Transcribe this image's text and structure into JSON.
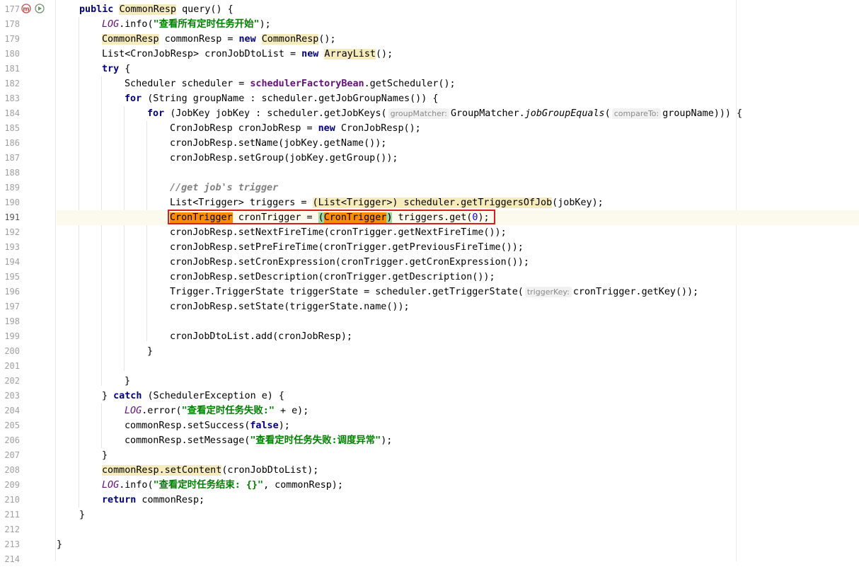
{
  "editor": {
    "line_numbers": [
      "177",
      "178",
      "179",
      "180",
      "181",
      "182",
      "183",
      "184",
      "185",
      "186",
      "187",
      "188",
      "189",
      "190",
      "191",
      "192",
      "193",
      "194",
      "195",
      "196",
      "197",
      "198",
      "199",
      "200",
      "201",
      "202",
      "203",
      "204",
      "205",
      "206",
      "207",
      "208",
      "209",
      "210",
      "211",
      "212",
      "213",
      "214"
    ],
    "current_line": "191",
    "gutter_icons": {
      "line_177": [
        "override-method-icon",
        "run-debug-icon"
      ]
    },
    "hints": {
      "group_matcher": "groupMatcher:",
      "compare_to": "compareTo:",
      "trigger_key": "triggerKey:"
    },
    "tokens": {
      "public": "public",
      "try": "try",
      "for": "for",
      "new": "new",
      "catch": "catch",
      "return": "return",
      "false": "false",
      "CommonResp": "CommonResp",
      "ArrayList": "ArrayList",
      "LOG": "LOG",
      "query": " query() {",
      "str_start": "\"查看所有定时任务开始\"",
      "str_fail": "\"查看定时任务失败:\"",
      "str_fail_msg": "\"查看定时任务失败:调度异常\"",
      "str_end": "\"查看定时任务结束: {}\"",
      "schedulerFactoryBean": "schedulerFactoryBean",
      "jobGroupEquals": "jobGroupEquals",
      "comment": "//get job's trigger",
      "CronTrigger": "CronTrigger",
      "List_Trigger_cast": "(List<Trigger>)",
      "getTriggersOfJob": "scheduler.getTriggersOfJob",
      "zero": "0",
      "setContent": "commonResp.setContent"
    },
    "text": {
      "l178_b": ".info(",
      "l178_c": ");",
      "l179_b": " commonResp = ",
      "l179_c": "();",
      "l180_a": "List<CronJobResp> cronJobDtoList = ",
      "l180_c": "();",
      "l181_b": " {",
      "l182_a": "Scheduler scheduler = ",
      "l182_c": ".getScheduler();",
      "l183_b": " (String groupName : scheduler.getJobGroupNames()) {",
      "l184_b": " (JobKey jobKey : scheduler.getJobKeys(",
      "l184_c": "GroupMatcher.",
      "l184_d": "(",
      "l184_e": "groupName))) {",
      "l185_a": "CronJobResp cronJobResp = ",
      "l185_c": " CronJobResp();",
      "l186": "cronJobResp.setName(jobKey.getName());",
      "l187": "cronJobResp.setGroup(jobKey.getGroup());",
      "l190_a": "List<Trigger> triggers = ",
      "l190_c": "(jobKey);",
      "l191_b": " cronTrigger = ",
      "l191_d": ") triggers.get(",
      "l191_e": ");",
      "l192": "cronJobResp.setNextFireTime(cronTrigger.getNextFireTime());",
      "l193": "cronJobResp.setPreFireTime(cronTrigger.getPreviousFireTime());",
      "l194": "cronJobResp.setCronExpression(cronTrigger.getCronExpression());",
      "l195": "cronJobResp.setDescription(cronTrigger.getDescription());",
      "l196_a": "Trigger.TriggerState triggerState = scheduler.getTriggerState(",
      "l196_b": "cronTrigger.getKey());",
      "l197": "cronJobResp.setState(triggerState.name());",
      "l199": "cronJobDtoList.add(cronJobResp);",
      "close": "}",
      "l203_a": "} ",
      "l203_c": " (SchedulerException e) {",
      "l204_b": ".error(",
      "l204_c": " + e);",
      "l205_a": "commonResp.setSuccess(",
      "l205_c": ");",
      "l206_a": "commonResp.setMessage(",
      "l206_c": ");",
      "l208_b": "(cronJobDtoList);",
      "l209_b": ".info(",
      "l209_c": ", commonResp);",
      "l210_b": " commonResp;"
    }
  },
  "colors": {
    "keyword": "#000080",
    "string": "#008000",
    "field": "#660e7a",
    "selection": "#ff8c00",
    "usage_highlight": "#f6ebbc",
    "annotation_box": "#d42020"
  }
}
